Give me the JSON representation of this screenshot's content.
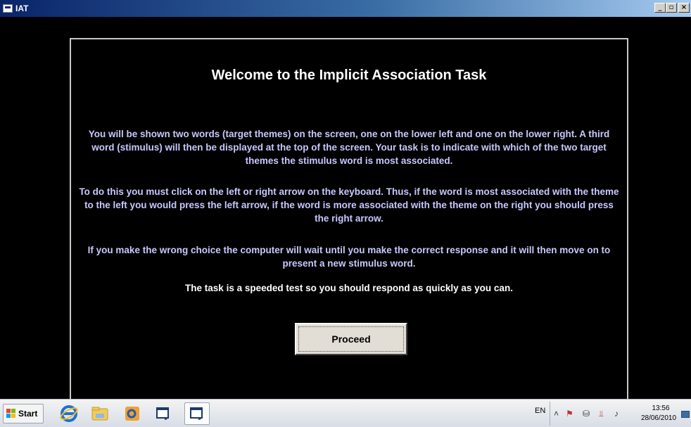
{
  "window": {
    "title": "IAT",
    "minimize_label": "_",
    "maximize_label": "▫",
    "close_label": "×"
  },
  "main": {
    "heading": "Welcome to the Implicit Association Task",
    "paragraph1": "You will be shown two words (target themes) on the screen, one on the lower left and one on the lower right. A third word (stimulus) will then be displayed at the top of the screen. Your task is to indicate with which of the two target themes the stimulus word is most associated.",
    "paragraph2": "To do this you must click on the left or right arrow on the keyboard. Thus, if the word is most associated with the theme to the left you would press the left arrow, if the word is more associated with the theme on the right you should press the right arrow.",
    "paragraph3": "If you make the wrong choice the computer will wait until you make the correct response and it will then move on to present a new stimulus word.",
    "paragraph4": "The task is a speeded test so you should respond as quickly as you can.",
    "proceed_label": "Proceed"
  },
  "taskbar": {
    "start_label": "Start",
    "items": [
      {
        "icon": "internet-explorer-icon"
      },
      {
        "icon": "file-explorer-icon"
      },
      {
        "icon": "outlook-icon"
      },
      {
        "icon": "window-app-icon"
      },
      {
        "icon": "window-app-icon-active"
      }
    ],
    "language": "EN",
    "clock_time": "13:56",
    "clock_date": "28/06/2010"
  },
  "colors": {
    "background": "#000000",
    "paragraph_text": "#c8c8ff",
    "heading_text": "#ffffff",
    "titlebar": "#0a246a"
  }
}
